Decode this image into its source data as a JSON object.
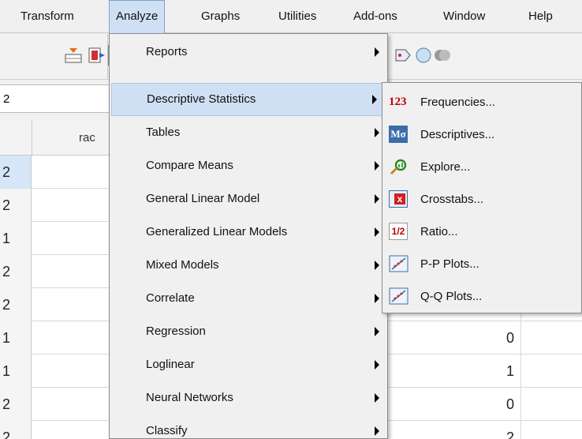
{
  "menubar": {
    "items": [
      {
        "label": "Transform",
        "active": false
      },
      {
        "label": "Analyze",
        "active": true
      },
      {
        "label": "Graphs",
        "active": false
      },
      {
        "label": "Utilities",
        "active": false
      },
      {
        "label": "Add-ons",
        "active": false
      },
      {
        "label": "Window",
        "active": false
      },
      {
        "label": "Help",
        "active": false
      }
    ]
  },
  "cellref": {
    "value": "2"
  },
  "grid": {
    "column_header": "rac",
    "rows": [
      {
        "num": "2",
        "value": ""
      },
      {
        "num": "2",
        "value": ""
      },
      {
        "num": "1",
        "value": ""
      },
      {
        "num": "2",
        "value": ""
      },
      {
        "num": "2",
        "value": ""
      },
      {
        "num": "1",
        "value": "0"
      },
      {
        "num": "1",
        "value": "1"
      },
      {
        "num": "2",
        "value": "0"
      },
      {
        "num": "2",
        "value": "2"
      }
    ]
  },
  "analyze_menu": {
    "items": [
      {
        "label": "Reports",
        "highlighted": false
      },
      {
        "label": "Descriptive Statistics",
        "highlighted": true
      },
      {
        "label": "Tables",
        "highlighted": false
      },
      {
        "label": "Compare Means",
        "highlighted": false
      },
      {
        "label": "General Linear Model",
        "highlighted": false
      },
      {
        "label": "Generalized Linear Models",
        "highlighted": false
      },
      {
        "label": "Mixed Models",
        "highlighted": false
      },
      {
        "label": "Correlate",
        "highlighted": false
      },
      {
        "label": "Regression",
        "highlighted": false
      },
      {
        "label": "Loglinear",
        "highlighted": false
      },
      {
        "label": "Neural Networks",
        "highlighted": false
      },
      {
        "label": "Classify",
        "highlighted": false
      }
    ]
  },
  "descriptive_submenu": {
    "items": [
      {
        "label": "Frequencies...",
        "icon": "frequencies-icon",
        "icon_text": "123"
      },
      {
        "label": "Descriptives...",
        "icon": "descriptives-icon",
        "icon_text": "Mσ"
      },
      {
        "label": "Explore...",
        "icon": "explore-icon",
        "icon_text": ""
      },
      {
        "label": "Crosstabs...",
        "icon": "crosstabs-icon",
        "icon_text": "x"
      },
      {
        "label": "Ratio...",
        "icon": "ratio-icon",
        "icon_text": "1/2"
      },
      {
        "label": "P-P Plots...",
        "icon": "pp-plots-icon",
        "icon_text": ""
      },
      {
        "label": "Q-Q Plots...",
        "icon": "qq-plots-icon",
        "icon_text": ""
      }
    ]
  },
  "colors": {
    "highlight": "#cfe0f4",
    "highlight_border": "#7da2ce",
    "frequencies_red": "#c00000"
  }
}
